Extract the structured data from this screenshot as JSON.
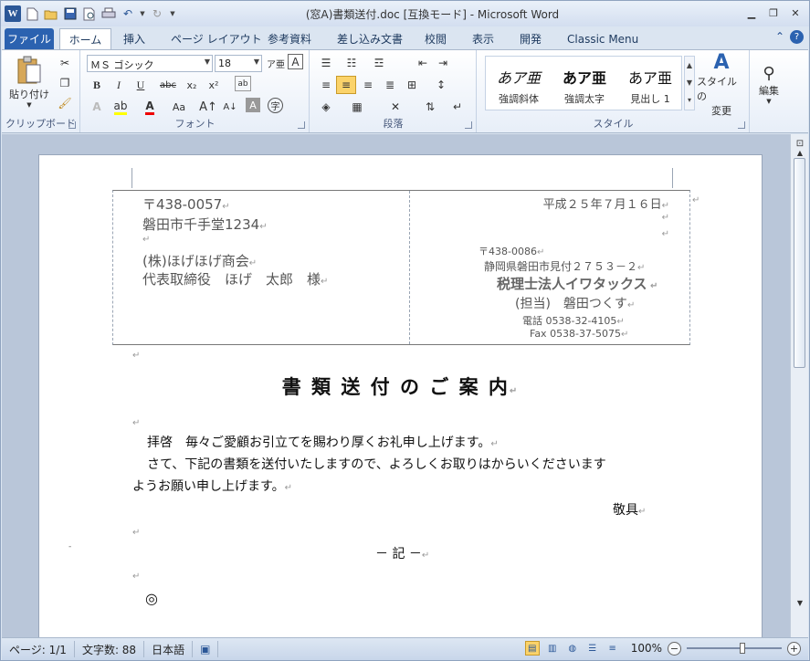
{
  "window": {
    "title": "(窓A)書類送付.doc [互換モード] - Microsoft Word"
  },
  "tabs": [
    "ファイル",
    "ホーム",
    "挿入",
    "ページ レイアウト",
    "参考資料",
    "差し込み文書",
    "校閲",
    "表示",
    "開発",
    "Classic Menu"
  ],
  "ribbon": {
    "clipboard": {
      "label": "クリップボード",
      "paste": "貼り付け"
    },
    "font": {
      "label": "フォント",
      "font_name": "ＭＳ ゴシック",
      "font_size": "18"
    },
    "paragraph": {
      "label": "段落"
    },
    "styles": {
      "label": "スタイル",
      "items": [
        {
          "sample": "あア亜",
          "name": "強調斜体"
        },
        {
          "sample": "あア亜",
          "name": "強調太字"
        },
        {
          "sample": "あア亜",
          "name": "見出し 1"
        }
      ],
      "change_styles": [
        "スタイルの",
        "変更"
      ]
    },
    "editing": {
      "label": "編集"
    }
  },
  "document": {
    "recipient": {
      "zip": "〒438-0057",
      "address": "磐田市千手堂1234",
      "company": "(株)ほげほげ商会",
      "person": "代表取締役　ほげ　太郎　様"
    },
    "sender": {
      "date": "平成２５年７月１６日",
      "zip": "〒438-0086",
      "address": "静岡県磐田市見付２７５３－２",
      "company": "税理士法人イワタックス",
      "contact": "(担当)　磐田つくす",
      "phone": "電話  0538-32-4105",
      "fax": "Fax  0538-37-5075"
    },
    "title": "書 類 送 付 の ご 案 内",
    "greeting": "拝啓　毎々ご愛顧お引立てを賜わり厚くお礼申し上げます。",
    "body_line1": "さて、下記の書類を送付いたしますので、よろしくお取りはからいくださいます",
    "body_line2": "ようお願い申し上げます。",
    "closing": "敬具",
    "ki": "－ 記 －",
    "item_mark": "◎"
  },
  "status": {
    "page": "ページ: 1/1",
    "words": "文字数: 88",
    "language": "日本語",
    "zoom": "100%"
  }
}
